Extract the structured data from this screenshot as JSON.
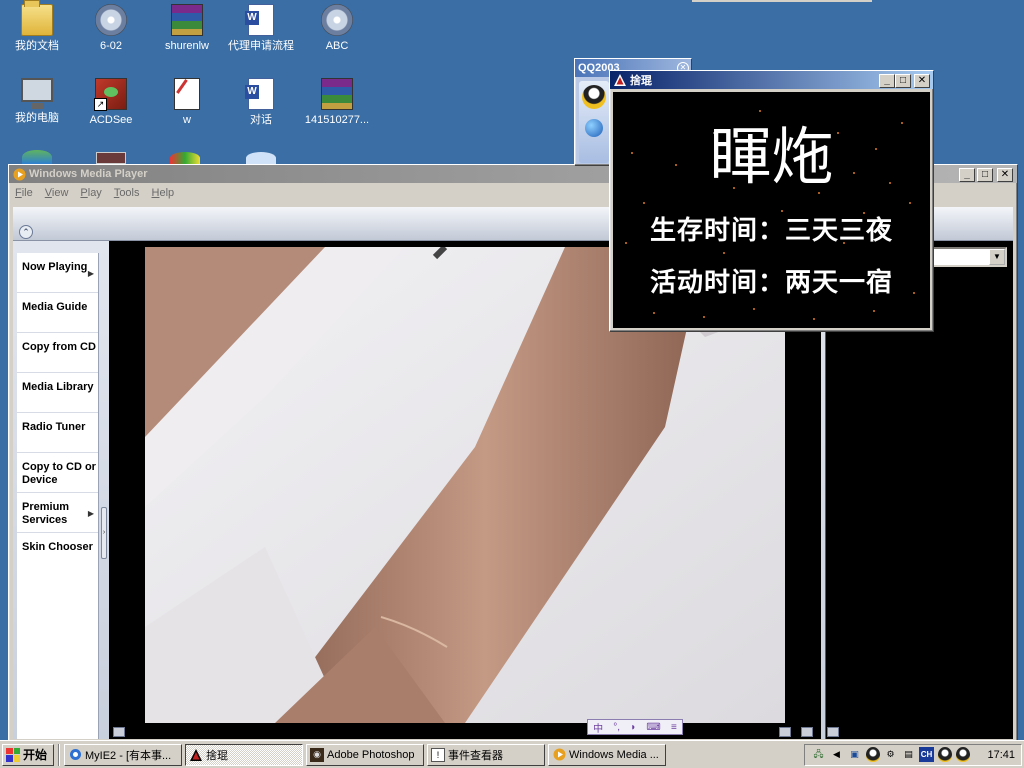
{
  "desktop": {
    "icons": [
      {
        "label": "我的文档",
        "icon": "folder-icon"
      },
      {
        "label": "6-02",
        "icon": "document-icon"
      },
      {
        "label": "shurenlw",
        "icon": "winrar-archive-icon"
      },
      {
        "label": "代理申请流程",
        "icon": "word-document-icon"
      },
      {
        "label": "ABC",
        "icon": "disc-icon"
      },
      {
        "label": "我的电脑",
        "icon": "my-computer-icon"
      },
      {
        "label": "ACDSee",
        "icon": "acdsee-icon"
      },
      {
        "label": "w",
        "icon": "pencil-document-icon"
      },
      {
        "label": "对话",
        "icon": "word-document-icon"
      },
      {
        "label": "141510277...",
        "icon": "winrar-archive-icon"
      }
    ]
  },
  "wmp": {
    "title": "Windows Media Player",
    "menu": [
      "File",
      "View",
      "Play",
      "Tools",
      "Help"
    ],
    "taskpane": [
      {
        "label": "Now Playing",
        "has_arrow": true
      },
      {
        "label": "Media Guide",
        "has_arrow": false
      },
      {
        "label": "Copy from CD",
        "has_arrow": false
      },
      {
        "label": "Media Library",
        "has_arrow": false
      },
      {
        "label": "Radio Tuner",
        "has_arrow": false
      },
      {
        "label": "Copy to CD or Device",
        "has_arrow": false
      },
      {
        "label": "Premium Services",
        "has_arrow": true
      },
      {
        "label": "Skin Chooser",
        "has_arrow": false
      }
    ]
  },
  "qq": {
    "title": "QQ2003"
  },
  "popup": {
    "title": "捨琨",
    "big_text": "睴炧",
    "line1": "生存时间：三天三夜",
    "line2": "活动时间：两天一宿"
  },
  "taskbar": {
    "start_label": "开始",
    "tasks": [
      {
        "label": "MyIE2 - [有本事...",
        "icon": "ie-icon",
        "pressed": false
      },
      {
        "label": "捨琨",
        "icon": "warning-app-icon",
        "pressed": true
      },
      {
        "label": "Adobe Photoshop",
        "icon": "photoshop-icon",
        "pressed": false
      },
      {
        "label": "事件查看器",
        "icon": "event-viewer-icon",
        "pressed": false
      },
      {
        "label": "Windows Media ...",
        "icon": "wmp-icon",
        "pressed": false
      }
    ],
    "tray_lang": "CH",
    "clock": "17:41"
  },
  "colors": {
    "desktop": "#3a6ea5",
    "title_active": "#0a246a",
    "title_inactive": "#808080",
    "popup_bg": "#000000",
    "star": "#e07a2a"
  }
}
